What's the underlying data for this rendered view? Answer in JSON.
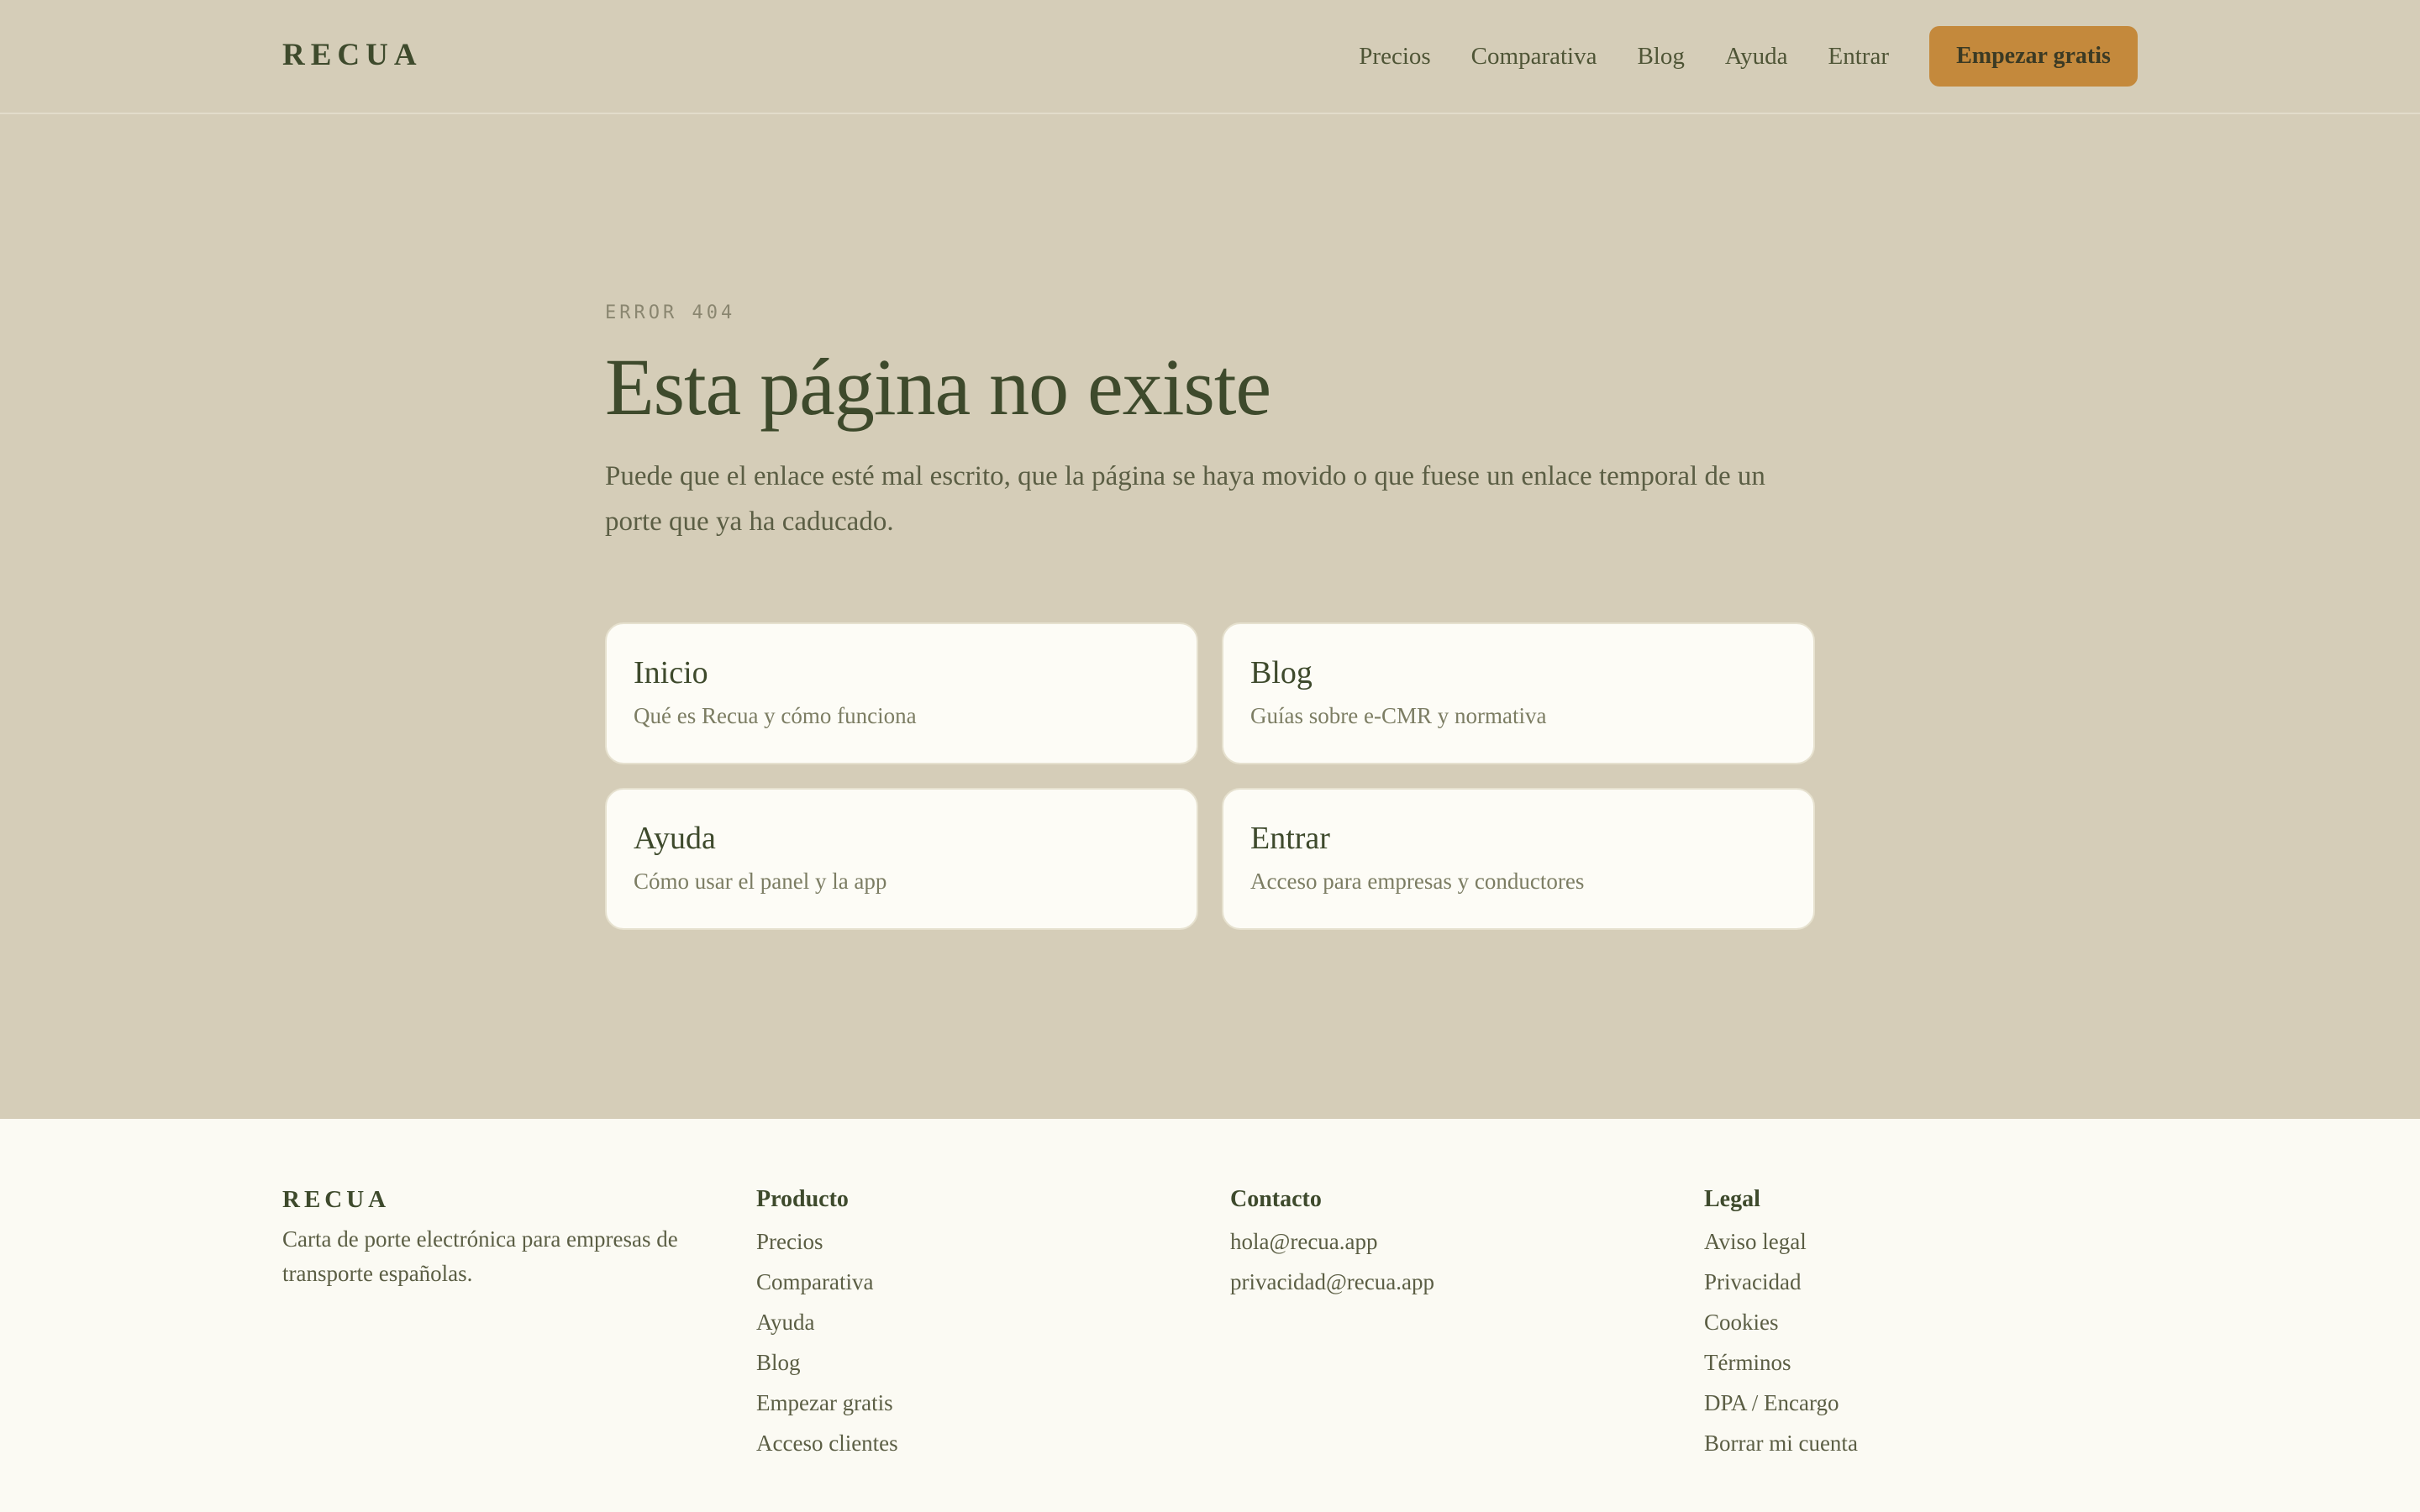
{
  "header": {
    "logo": "RECUA",
    "nav": [
      "Precios",
      "Comparativa",
      "Blog",
      "Ayuda",
      "Entrar"
    ],
    "cta": "Empezar gratis"
  },
  "main": {
    "eyebrow": "ERROR 404",
    "title": "Esta página no existe",
    "lead": "Puede que el enlace esté mal escrito, que la página se haya movido o que fuese un enlace temporal de un porte que ya ha caducado.",
    "cards": [
      {
        "title": "Inicio",
        "desc": "Qué es Recua y cómo funciona"
      },
      {
        "title": "Blog",
        "desc": "Guías sobre e-CMR y normativa"
      },
      {
        "title": "Ayuda",
        "desc": "Cómo usar el panel y la app"
      },
      {
        "title": "Entrar",
        "desc": "Acceso para empresas y conductores"
      }
    ]
  },
  "footer": {
    "brand": {
      "logo": "RECUA",
      "tagline": "Carta de porte electrónica para empresas de transporte españolas."
    },
    "producto": {
      "heading": "Producto",
      "links": [
        "Precios",
        "Comparativa",
        "Ayuda",
        "Blog",
        "Empezar gratis",
        "Acceso clientes"
      ]
    },
    "contacto": {
      "heading": "Contacto",
      "links": [
        "hola@recua.app",
        "privacidad@recua.app"
      ]
    },
    "legal": {
      "heading": "Legal",
      "links": [
        "Aviso legal",
        "Privacidad",
        "Cookies",
        "Términos",
        "DPA / Encargo",
        "Borrar mi cuenta"
      ]
    }
  },
  "colors": {
    "background": "#d5cdb8",
    "accent": "#c4893c",
    "text": "#3e4a2c",
    "card": "#fdfcf6",
    "footer": "#fbfaf3"
  }
}
